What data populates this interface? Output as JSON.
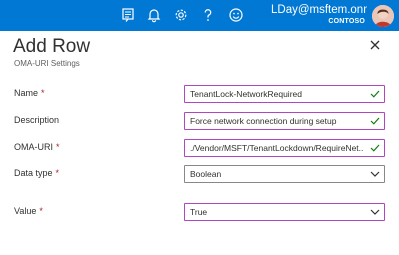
{
  "header": {
    "icons": [
      "feedback-icon",
      "bell-icon",
      "gear-icon",
      "help-icon",
      "smiley-icon"
    ],
    "user": "LDay@msftem.onmicro...",
    "org": "CONTOSO"
  },
  "panel": {
    "title": "Add Row",
    "subtitle": "OMA-URI Settings"
  },
  "form": {
    "name": {
      "label": "Name",
      "required": "*",
      "value": "TenantLock-NetworkRequired"
    },
    "description": {
      "label": "Description",
      "value": "Force network connection during setup"
    },
    "oma_uri": {
      "label": "OMA-URI",
      "required": "*",
      "value": "./Vendor/MSFT/TenantLockdown/RequireNet..."
    },
    "data_type": {
      "label": "Data type",
      "required": "*",
      "value": "Boolean"
    },
    "value": {
      "label": "Value",
      "required": "*",
      "value": "True"
    }
  },
  "colors": {
    "topbar": "#0078d4",
    "valid_border": "#b146c2",
    "check": "#107c10",
    "required": "#a4262c"
  }
}
